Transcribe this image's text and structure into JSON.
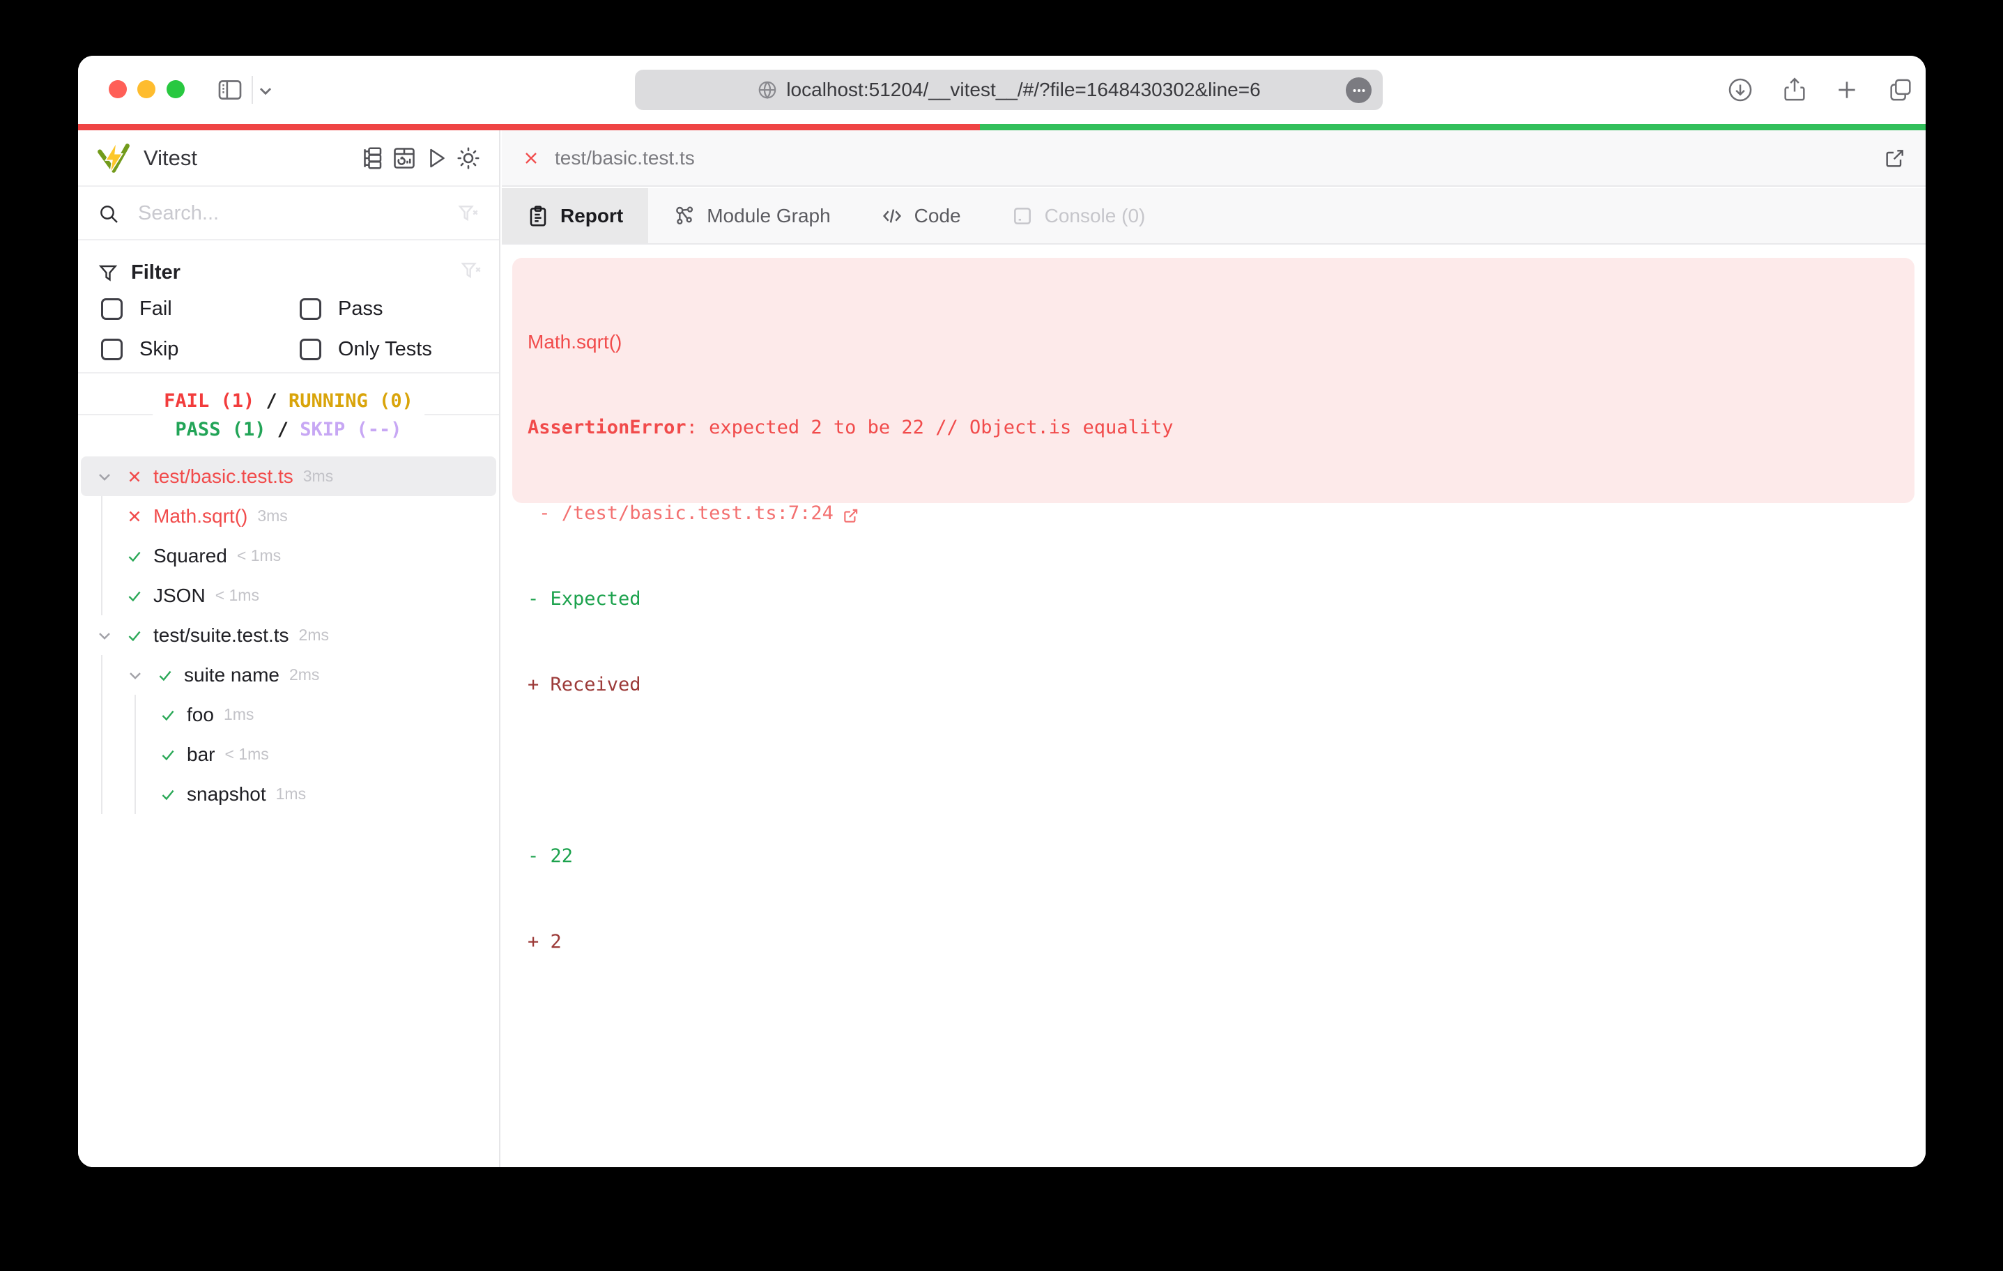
{
  "browser": {
    "url": "localhost:51204/__vitest__/#/?file=1648430302&line=6",
    "traffic_lights": [
      "close",
      "minimize",
      "zoom"
    ],
    "left_icons": [
      "sidebar-toggle-icon",
      "chevron-down-icon"
    ],
    "url_icons": [
      "globe-icon",
      "ellipsis-icon"
    ],
    "right_icons": [
      "download-icon",
      "share-icon",
      "new-tab-icon",
      "tab-overview-icon"
    ]
  },
  "progress": {
    "fail_color": "#ef4444",
    "pass_color": "#32bf5b",
    "fail_fraction": "48.8%"
  },
  "sidebar": {
    "app_title": "Vitest",
    "toolbar_icons": [
      "expand-tree-icon",
      "dashboard-icon",
      "run-all-icon",
      "theme-sun-icon"
    ],
    "search": {
      "placeholder": "Search...",
      "value": "",
      "clear_icon": "funnel-x-icon"
    },
    "filter": {
      "title": "Filter",
      "icon": "funnel-icon",
      "clear_icon": "funnel-x-icon",
      "options": [
        {
          "label": "Fail",
          "checked": false
        },
        {
          "label": "Pass",
          "checked": false
        },
        {
          "label": "Skip",
          "checked": false
        },
        {
          "label": "Only Tests",
          "checked": false
        }
      ]
    },
    "stats": {
      "fail": "FAIL (1)",
      "running": "RUNNING (0)",
      "pass": "PASS (1)",
      "skip": "SKIP (--)",
      "separator": "/"
    },
    "tree": [
      {
        "label": "test/basic.test.ts",
        "duration": "3ms",
        "status": "fail",
        "level": 1,
        "expanded": true,
        "selected": true
      },
      {
        "label": "Math.sqrt()",
        "duration": "3ms",
        "status": "fail",
        "level": 2
      },
      {
        "label": "Squared",
        "duration": "< 1ms",
        "status": "pass",
        "level": 2
      },
      {
        "label": "JSON",
        "duration": "< 1ms",
        "status": "pass",
        "level": 2
      },
      {
        "label": "test/suite.test.ts",
        "duration": "2ms",
        "status": "pass",
        "level": 1,
        "expanded": true
      },
      {
        "label": "suite name",
        "duration": "2ms",
        "status": "pass",
        "level": 2,
        "expanded": true
      },
      {
        "label": "foo",
        "duration": "1ms",
        "status": "pass",
        "level": 3
      },
      {
        "label": "bar",
        "duration": "< 1ms",
        "status": "pass",
        "level": 3
      },
      {
        "label": "snapshot",
        "duration": "1ms",
        "status": "pass",
        "level": 3
      }
    ]
  },
  "main": {
    "file_tab": {
      "label": "test/basic.test.ts",
      "close_icon": "close-x-icon",
      "external_icon": "external-link-icon"
    },
    "tabs": [
      {
        "label": "Report",
        "icon": "clipboard-icon",
        "active": true
      },
      {
        "label": "Module Graph",
        "icon": "module-graph-icon",
        "active": false
      },
      {
        "label": "Code",
        "icon": "code-icon",
        "active": false
      },
      {
        "label": "Console (0)",
        "icon": "console-icon",
        "active": false,
        "disabled": true
      }
    ],
    "report": {
      "test_name": "Math.sqrt()",
      "error_name": "AssertionError",
      "error_message": ": expected 2 to be 22 // Object.is equality",
      "stack_line": " - /test/basic.test.ts:7:24",
      "diff_expected_label": "- Expected",
      "diff_received_label": "+ Received",
      "diff_expected_value": "- 22",
      "diff_received_value": "+ 2"
    }
  },
  "colors": {
    "fail": "#ef4444",
    "pass": "#22a457",
    "running": "#d9a40a",
    "skip": "#c7a7f4",
    "error_bg": "#fdeaea",
    "diff_expected": "#1ca24d",
    "diff_received": "#9c3a38",
    "progress_fail": "#ef4444",
    "progress_pass": "#32bf5b"
  }
}
